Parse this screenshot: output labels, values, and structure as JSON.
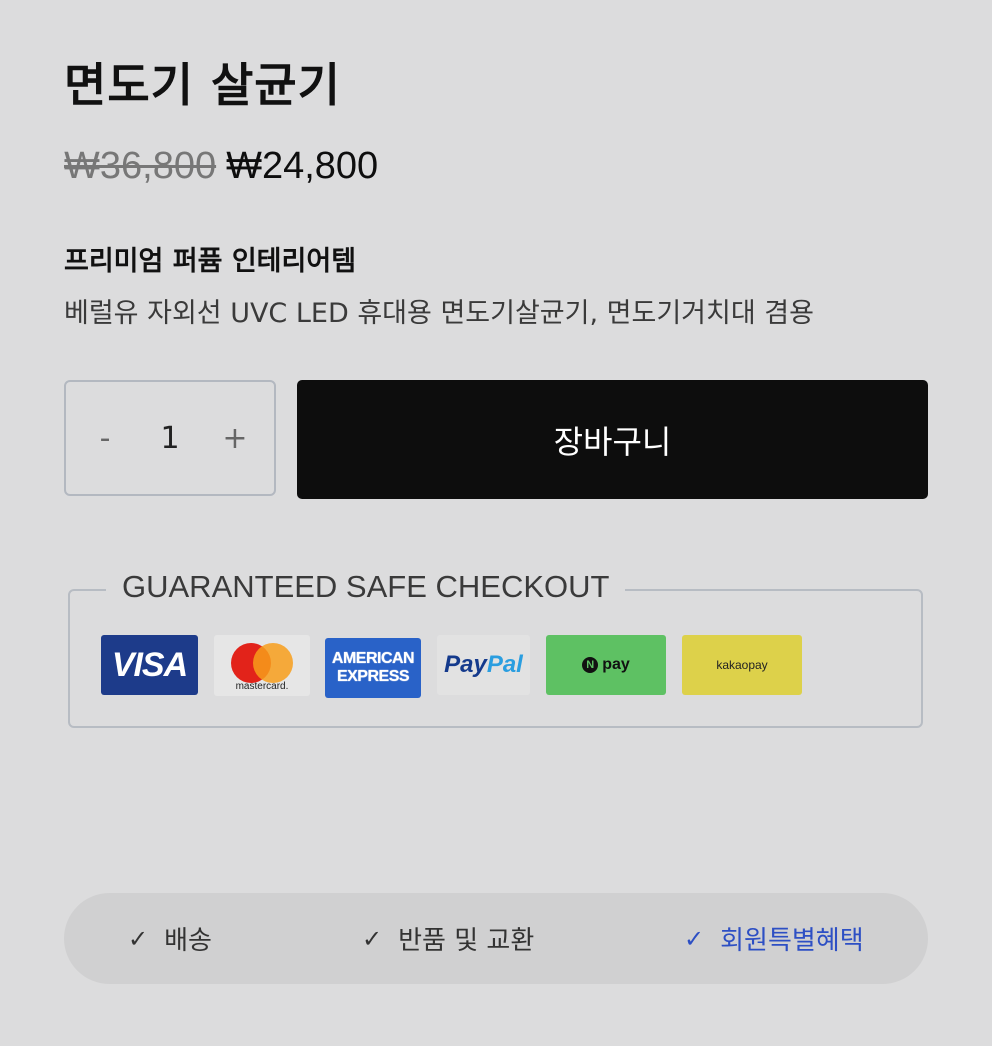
{
  "product": {
    "title": "면도기 살균기",
    "price_original": "₩36,800",
    "price_sale": "₩24,800",
    "subtitle": "프리미엄 퍼퓸 인테리어템",
    "description": "베럴유 자외선 UVC LED 휴대용 면도기살균기, 면도기거치대 겸용"
  },
  "quantity": {
    "decrement_label": "-",
    "value": "1",
    "increment_label": "+"
  },
  "cart": {
    "button_label": "장바구니"
  },
  "checkout": {
    "legend": "GUARANTEED SAFE CHECKOUT",
    "payment_methods": {
      "visa": "VISA",
      "mastercard": "mastercard.",
      "amex_line1": "AMERICAN",
      "amex_line2": "EXPRESS",
      "paypal_a": "Pay",
      "paypal_b": "Pal",
      "npay_n": "N",
      "npay": "pay",
      "kakaopay": "kakaopay"
    }
  },
  "tabs": {
    "shipping": "배송",
    "return": "반품 및 교환",
    "member": "회원특별혜택",
    "check_icon": "✓"
  },
  "colors": {
    "background": "#dcdcdd",
    "cart_button": "#0d0d0d",
    "active_tab": "#2d4fc4"
  }
}
